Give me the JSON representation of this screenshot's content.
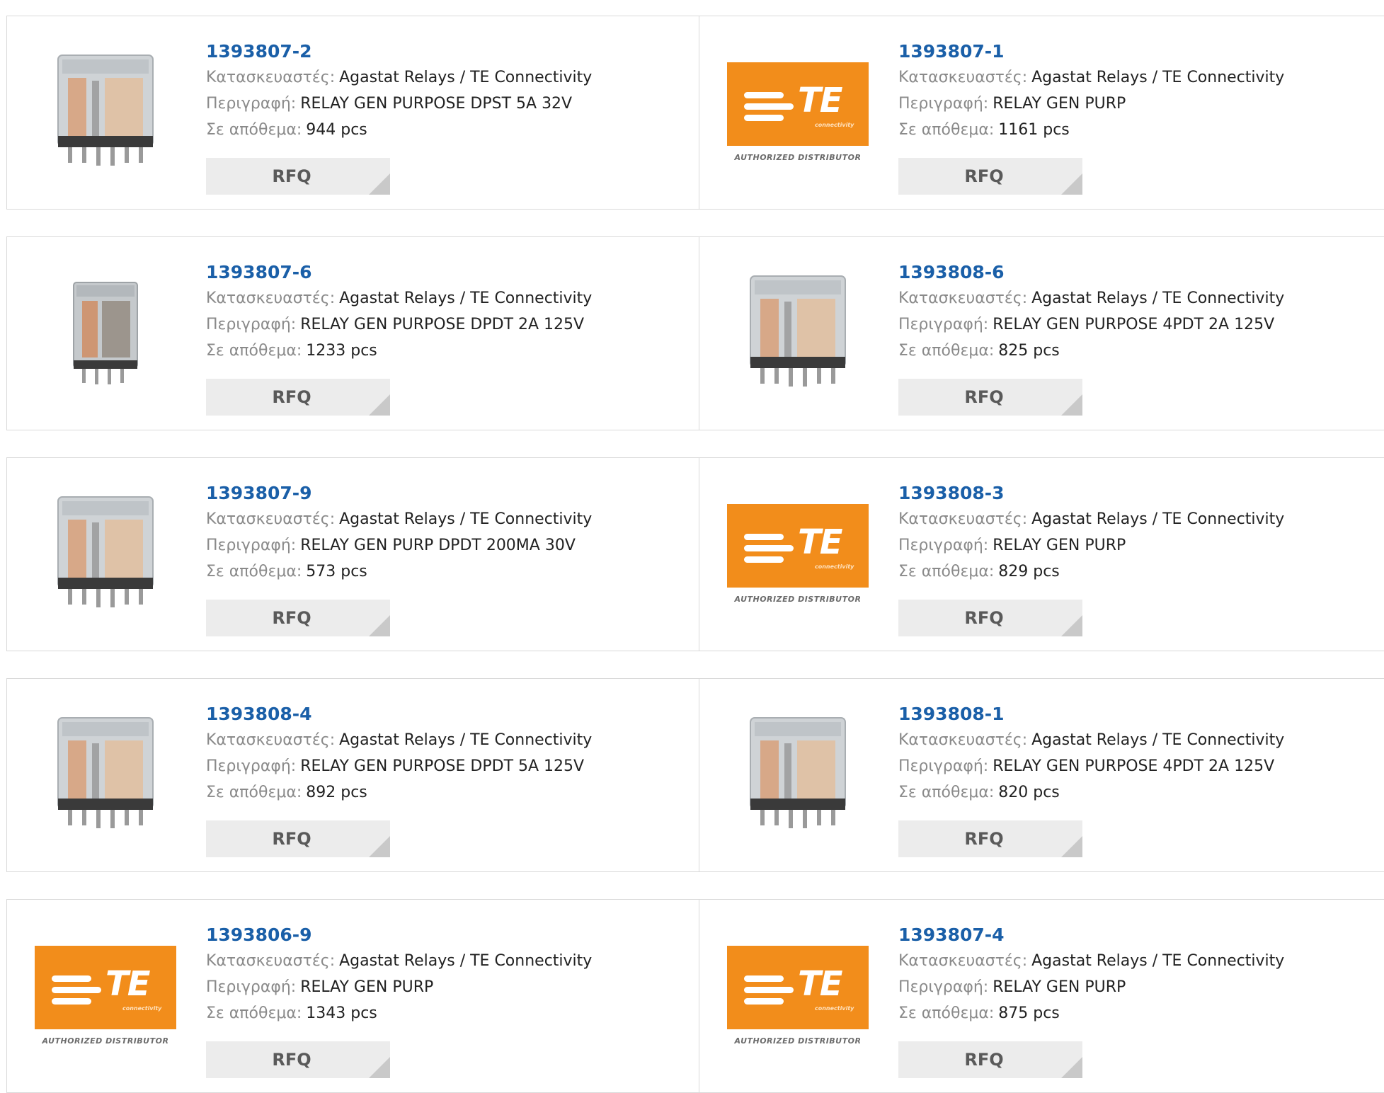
{
  "labels": {
    "manufacturer": "Κατασκευαστές:",
    "description": "Περιγραφή:",
    "stock": "Σε απόθεμα:",
    "rfq": "RFQ"
  },
  "logo": {
    "brand": "TE",
    "tagline": "connectivity",
    "caption": "AUTHORIZED DISTRIBUTOR"
  },
  "colors": {
    "part_link": "#1a5fa8",
    "te_orange": "#f28d1b",
    "border": "#d9d9d9",
    "rfq_bg": "#ececec"
  },
  "products": [
    {
      "part_number": "1393807-2",
      "manufacturer": "Agastat Relays / TE Connectivity",
      "description": "RELAY GEN PURPOSE DPST 5A 32V",
      "stock": "944 pcs",
      "image": "relay-image"
    },
    {
      "part_number": "1393807-1",
      "manufacturer": "Agastat Relays / TE Connectivity",
      "description": "RELAY GEN PURP",
      "stock": "1161 pcs",
      "image": "te-logo"
    },
    {
      "part_number": "1393807-6",
      "manufacturer": "Agastat Relays / TE Connectivity",
      "description": "RELAY GEN PURPOSE DPDT 2A 125V",
      "stock": "1233 pcs",
      "image": "relay-image-small"
    },
    {
      "part_number": "1393808-6",
      "manufacturer": "Agastat Relays / TE Connectivity",
      "description": "RELAY GEN PURPOSE 4PDT 2A 125V",
      "stock": "825 pcs",
      "image": "relay-image"
    },
    {
      "part_number": "1393807-9",
      "manufacturer": "Agastat Relays / TE Connectivity",
      "description": "RELAY GEN PURP DPDT 200MA 30V",
      "stock": "573 pcs",
      "image": "relay-image"
    },
    {
      "part_number": "1393808-3",
      "manufacturer": "Agastat Relays / TE Connectivity",
      "description": "RELAY GEN PURP",
      "stock": "829 pcs",
      "image": "te-logo"
    },
    {
      "part_number": "1393808-4",
      "manufacturer": "Agastat Relays / TE Connectivity",
      "description": "RELAY GEN PURPOSE DPDT 5A 125V",
      "stock": "892 pcs",
      "image": "relay-image"
    },
    {
      "part_number": "1393808-1",
      "manufacturer": "Agastat Relays / TE Connectivity",
      "description": "RELAY GEN PURPOSE 4PDT 2A 125V",
      "stock": "820 pcs",
      "image": "relay-image"
    },
    {
      "part_number": "1393806-9",
      "manufacturer": "Agastat Relays / TE Connectivity",
      "description": "RELAY GEN PURP",
      "stock": "1343 pcs",
      "image": "te-logo"
    },
    {
      "part_number": "1393807-4",
      "manufacturer": "Agastat Relays / TE Connectivity",
      "description": "RELAY GEN PURP",
      "stock": "875 pcs",
      "image": "te-logo"
    }
  ]
}
